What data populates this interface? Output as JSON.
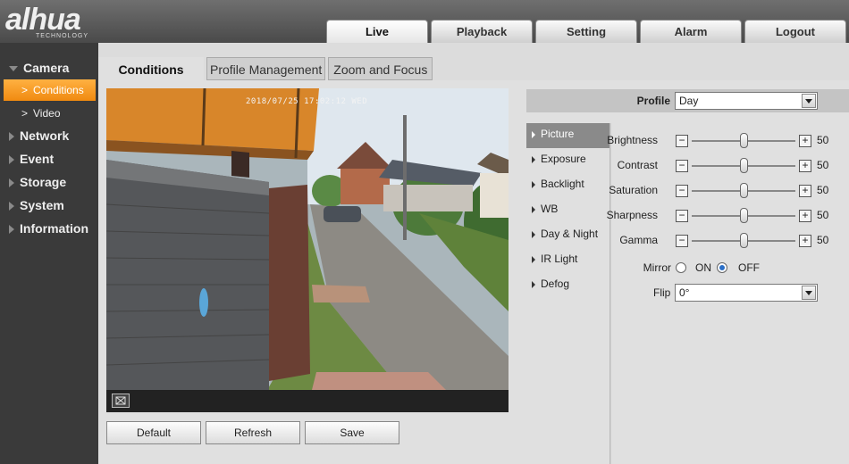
{
  "brand": {
    "logo": "alhua",
    "sub": "TECHNOLOGY"
  },
  "tabs": [
    {
      "label": "Live"
    },
    {
      "label": "Playback"
    },
    {
      "label": "Setting"
    },
    {
      "label": "Alarm"
    },
    {
      "label": "Logout"
    }
  ],
  "nav": {
    "camera": "Camera",
    "conditions": "Conditions",
    "video": "Video",
    "network": "Network",
    "event": "Event",
    "storage": "Storage",
    "system": "System",
    "information": "Information"
  },
  "subtabs": [
    {
      "label": "Conditions"
    },
    {
      "label": "Profile Management"
    },
    {
      "label": "Zoom and Focus"
    }
  ],
  "video": {
    "timestamp": "2018/07/25 17:02:12 WED"
  },
  "buttons": {
    "default": "Default",
    "refresh": "Refresh",
    "save": "Save"
  },
  "profile": {
    "label": "Profile",
    "value": "Day"
  },
  "categories": [
    {
      "label": "Picture"
    },
    {
      "label": "Exposure"
    },
    {
      "label": "Backlight"
    },
    {
      "label": "WB"
    },
    {
      "label": "Day & Night"
    },
    {
      "label": "IR Light"
    },
    {
      "label": "Defog"
    }
  ],
  "sliders": [
    {
      "label": "Brightness",
      "value": 50,
      "fraction": 0.5
    },
    {
      "label": "Contrast",
      "value": 50,
      "fraction": 0.5
    },
    {
      "label": "Saturation",
      "value": 50,
      "fraction": 0.5
    },
    {
      "label": "Sharpness",
      "value": 50,
      "fraction": 0.5
    },
    {
      "label": "Gamma",
      "value": 50,
      "fraction": 0.5
    }
  ],
  "mirror": {
    "label": "Mirror",
    "on": "ON",
    "off": "OFF",
    "selected": "OFF"
  },
  "flip": {
    "label": "Flip",
    "value": "0°"
  },
  "colors": {
    "accent": "#f08a10",
    "active_menu": "#8a8a8a"
  }
}
